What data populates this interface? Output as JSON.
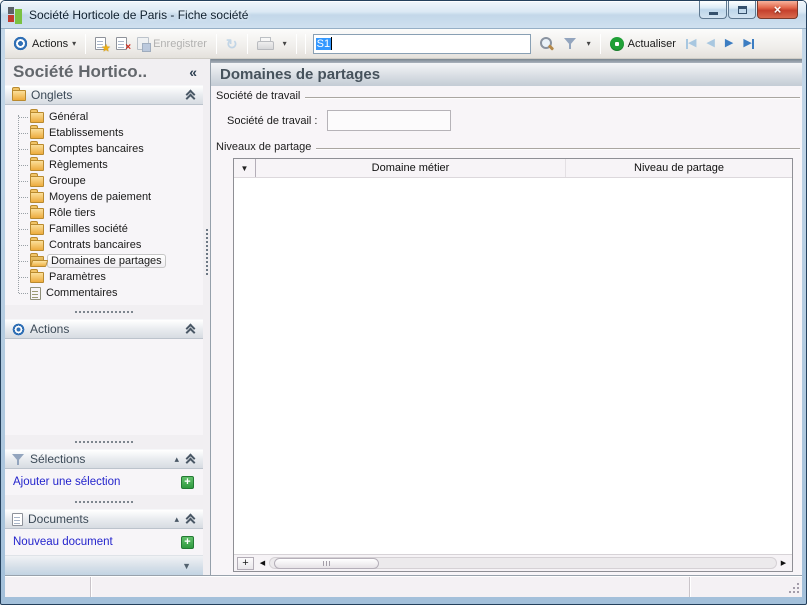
{
  "colors": {
    "accent": "#2f6fb5",
    "link": "#2424cc",
    "selection": "#3398ff",
    "plus_green": "#2f9a3f",
    "close_red": "#cb4631",
    "header_text": "#46525c"
  },
  "icons": {
    "caret_down": "▾",
    "collapse_left": "«",
    "collapse_up_single": "▴",
    "footer_down": "▼",
    "grid_indicator_down": "▼",
    "refresh_arrows": "↻",
    "star_badge": "★",
    "delete_cross": "×",
    "close_x": "×",
    "nav_left": "◀",
    "nav_right": "▶",
    "scroll_left": "◀",
    "scroll_right": "▶",
    "plus": "+"
  },
  "window": {
    "title": "Société Horticole de Paris -  Fiche société"
  },
  "toolbar": {
    "actions": {
      "label": "Actions"
    },
    "save": {
      "label": "Enregistrer"
    },
    "search": {
      "value": "S1"
    },
    "refresh": {
      "label": "Actualiser"
    }
  },
  "sidebar": {
    "title": "Société Hortico..",
    "onglets": {
      "label": "Onglets"
    },
    "tabs": [
      {
        "label": "Général"
      },
      {
        "label": "Etablissements"
      },
      {
        "label": "Comptes bancaires"
      },
      {
        "label": "Règlements"
      },
      {
        "label": "Groupe"
      },
      {
        "label": "Moyens de paiement"
      },
      {
        "label": "Rôle tiers"
      },
      {
        "label": "Familles société"
      },
      {
        "label": "Contrats bancaires"
      },
      {
        "label": "Domaines de partages",
        "selected": true
      },
      {
        "label": "Paramètres"
      },
      {
        "label": "Commentaires"
      }
    ],
    "actions_section": {
      "label": "Actions"
    },
    "selections_section": {
      "label": "Sélections",
      "add_link": "Ajouter une sélection"
    },
    "documents_section": {
      "label": "Documents",
      "add_link": "Nouveau document"
    }
  },
  "main": {
    "title": "Domaines de partages",
    "societe_travail": {
      "group_label": "Société de travail",
      "field_label": "Société de travail :",
      "field_value": ""
    },
    "niveaux": {
      "group_label": "Niveaux de partage",
      "grid": {
        "columns": [
          "Domaine métier",
          "Niveau de partage"
        ],
        "rows": []
      }
    }
  },
  "statusbar": {
    "panel1": "",
    "panel2": "",
    "panel3": ""
  }
}
